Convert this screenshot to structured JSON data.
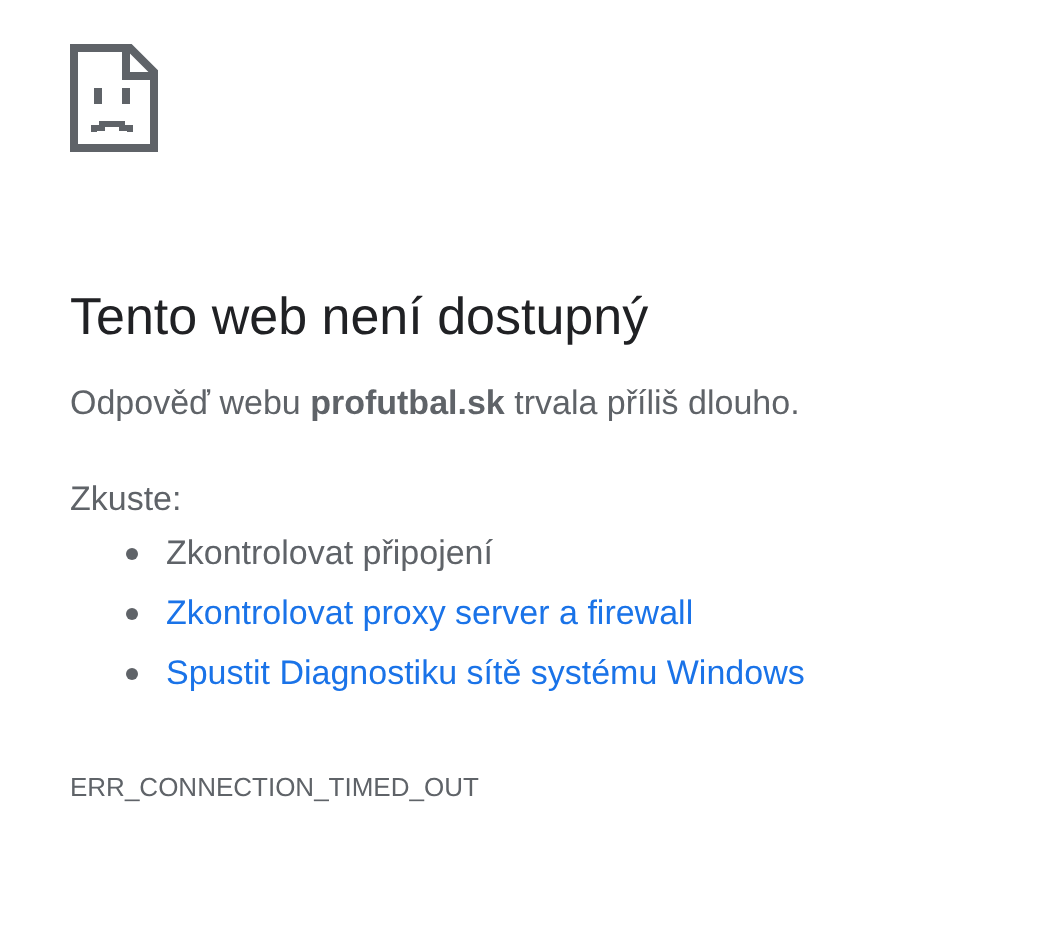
{
  "heading": "Tento web není dostupný",
  "message": "Odpověď webu **profutbal.sk** trvala příliš dlouho.",
  "suggestions_label": "Zkuste:",
  "suggestions": [
    {
      "kind": "text",
      "label": "Zkontrolovat připojení"
    },
    {
      "kind": "link",
      "label": "Zkontrolovat proxy server a firewall"
    },
    {
      "kind": "link",
      "label": "Spustit Diagnostiku sítě systému Windows"
    }
  ],
  "error_code": "ERR_CONNECTION_TIMED_OUT"
}
